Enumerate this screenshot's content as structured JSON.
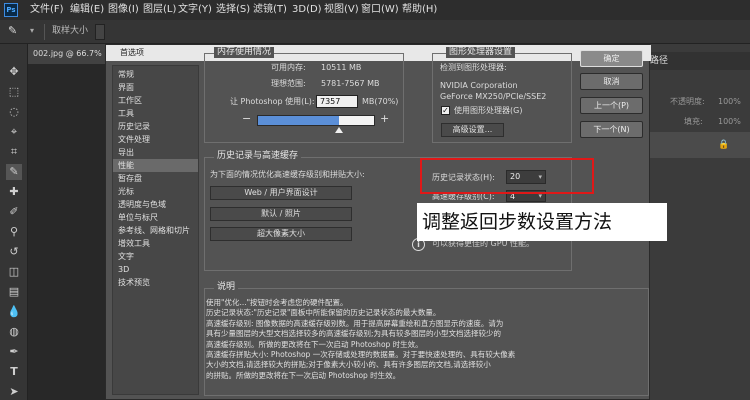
{
  "menubar": {
    "logo": "Ps",
    "items": [
      "文件(F)",
      "编辑(E)",
      "图像(I)",
      "图层(L)",
      "文字(Y)",
      "选择(S)",
      "滤镜(T)",
      "3D(D)",
      "视图(V)",
      "窗口(W)",
      "帮助(H)"
    ]
  },
  "optbar": {
    "label": "取样大小"
  },
  "doc_tab": {
    "label": "002.jpg @ 66.7%"
  },
  "right_panel": {
    "tab": "路径",
    "opacity_label": "不透明度:",
    "opacity_value": "100%",
    "fill_label": "填充:",
    "fill_value": "100%"
  },
  "dialog": {
    "title": "首选项",
    "categories": [
      "常规",
      "界面",
      "工作区",
      "工具",
      "历史记录",
      "文件处理",
      "导出",
      "性能",
      "暂存盘",
      "光标",
      "透明度与色域",
      "单位与标尺",
      "参考线、网格和切片",
      "增效工具",
      "文字",
      "3D",
      "技术预览"
    ],
    "selected_category": "性能",
    "memory": {
      "title": "内存使用情况",
      "available_label": "可用内存:",
      "available_value": "10511 MB",
      "ideal_label": "理想范围:",
      "ideal_value": "5781-7567 MB",
      "let_label": "让 Photoshop 使用(L):",
      "let_value": "7357",
      "let_suffix": "MB(70%)",
      "slider_fraction": 0.7
    },
    "gpu": {
      "title": "图形处理器设置",
      "detected_label": "检测到图形处理器:",
      "name_line1": "NVIDIA Corporation",
      "name_line2": "GeForce MX250/PCIe/SSE2",
      "use_label": "使用图形处理器(G)",
      "advanced_button": "高级设置..."
    },
    "history": {
      "title": "历史记录与高速缓存",
      "optimize_label": "为下面的情况优化高速缓存级别和拼贴大小:",
      "buttons": [
        "Web / 用户界面设计",
        "默认 / 照片",
        "超大像素大小"
      ],
      "states_label": "历史记录状态(H):",
      "states_value": "20",
      "cache_label": "高速缓存级别(C):",
      "cache_value": "4",
      "gpu_note": "可以获得更佳的 GPU 性能。"
    },
    "buttons": {
      "ok": "确定",
      "cancel": "取消",
      "prev": "上一个(P)",
      "next": "下一个(N)"
    },
    "description": {
      "title": "说明",
      "lines": [
        "使用\"优化...\"按钮时会考虑您的硬件配置。",
        "历史记录状态:\"历史记录\"面板中所能保留的历史记录状态的最大数量。",
        "高速缓存级别: 图像数据的高速缓存级别数。用于提高屏幕重绘和直方图显示的速度。请为",
        "具有少量图层的大型文档选择较多的高速缓存级别;为具有较多图层的小型文档选择较少的",
        "高速缓存级别。所做的更改将在下一次启动 Photoshop 时生效。",
        "高速缓存拼贴大小: Photoshop 一次存储或处理的数据量。对于要快速处理的、具有较大像素",
        "大小的文档,请选择较大的拼贴;对于像素大小较小的、具有许多图层的文档,请选择较小",
        "的拼贴。所做的更改将在下一次启动 Photoshop 时生效。"
      ]
    }
  },
  "overlay_text": "调整返回步数设置方法",
  "colors": {
    "highlight": "#e01818",
    "slider_fill": "#5b8fd8"
  }
}
